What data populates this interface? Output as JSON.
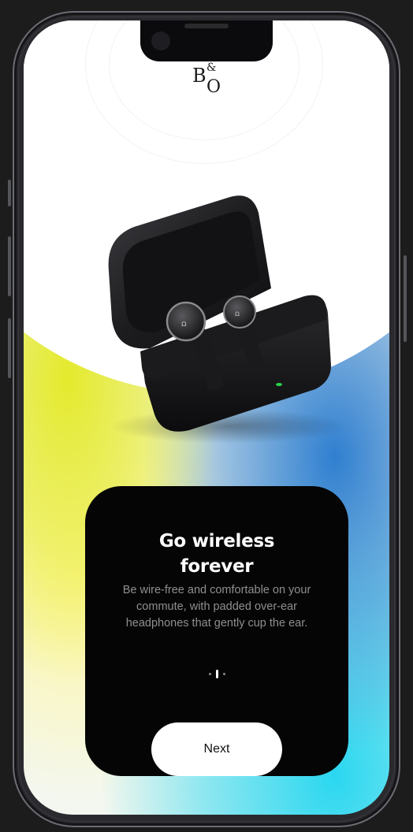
{
  "brand": {
    "logo_b": "B",
    "logo_amp": "&",
    "logo_o": "O"
  },
  "card": {
    "title": "Go wireless forever",
    "description": "Be wire-free and comfortable on your commute, with padded over-ear headphones that gently cup the ear.",
    "pagination": {
      "total": 3,
      "active_index": 1
    },
    "next_button_label": "Next"
  },
  "colors": {
    "card_background": "#050505",
    "button_background": "#ffffff",
    "gradient_yellow": "#e4ea2b",
    "gradient_blue": "#2f7fd0",
    "gradient_cyan": "#2ad7f0",
    "indicator_green": "#2bd64a"
  }
}
